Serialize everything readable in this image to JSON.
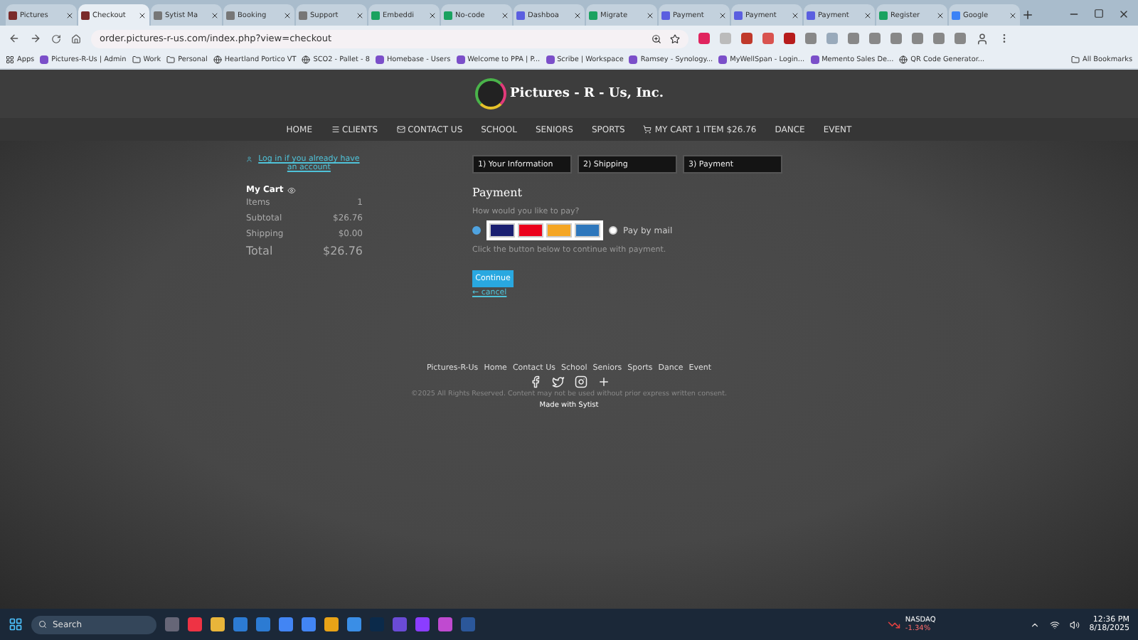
{
  "browser": {
    "tabs": [
      {
        "label": "Pictures",
        "selected": false,
        "color": "#7a2a2a"
      },
      {
        "label": "Checkout",
        "selected": true,
        "color": "#7a2a2a"
      },
      {
        "label": "Sytist Ma",
        "selected": false,
        "color": "#777777"
      },
      {
        "label": "Booking",
        "selected": false,
        "color": "#777777"
      },
      {
        "label": "Support",
        "selected": false,
        "color": "#777777"
      },
      {
        "label": "Embeddi",
        "selected": false,
        "color": "#1aa260"
      },
      {
        "label": "No-code",
        "selected": false,
        "color": "#1aa260"
      },
      {
        "label": "Dashboa",
        "selected": false,
        "color": "#5b5fe0"
      },
      {
        "label": "Migrate",
        "selected": false,
        "color": "#1aa260"
      },
      {
        "label": "Payment",
        "selected": false,
        "color": "#5b5fe0"
      },
      {
        "label": "Payment",
        "selected": false,
        "color": "#5b5fe0"
      },
      {
        "label": "Payment",
        "selected": false,
        "color": "#5b5fe0"
      },
      {
        "label": "Register",
        "selected": false,
        "color": "#1aa260"
      },
      {
        "label": "Google",
        "selected": false,
        "color": "#3b82f6"
      }
    ],
    "url": "order.pictures-r-us.com/index.php?view=checkout",
    "bookmarks": [
      {
        "label": "Apps",
        "kind": "apps"
      },
      {
        "label": "Pictures-R-Us | Admin",
        "kind": "site"
      },
      {
        "label": "Work",
        "kind": "folder"
      },
      {
        "label": "Personal",
        "kind": "folder"
      },
      {
        "label": "Heartland Portico VT",
        "kind": "globe"
      },
      {
        "label": "SCO2 - Pallet - 8",
        "kind": "globe"
      },
      {
        "label": "Homebase - Users",
        "kind": "site"
      },
      {
        "label": "Welcome to PPA | P...",
        "kind": "site"
      },
      {
        "label": "Scribe | Workspace",
        "kind": "site"
      },
      {
        "label": "Ramsey - Synology...",
        "kind": "site"
      },
      {
        "label": "MyWellSpan - Login...",
        "kind": "site"
      },
      {
        "label": "Memento Sales De...",
        "kind": "site"
      },
      {
        "label": "QR Code Generator...",
        "kind": "globe"
      }
    ],
    "all_bookmarks": "All Bookmarks"
  },
  "site": {
    "brand": "Pictures - R - Us, Inc.",
    "nav": [
      {
        "label": "HOME",
        "kind": "plain"
      },
      {
        "label": "CLIENTS",
        "kind": "menu"
      },
      {
        "label": "CONTACT US",
        "kind": "mail"
      },
      {
        "label": "SCHOOL",
        "kind": "plain"
      },
      {
        "label": "SENIORS",
        "kind": "plain"
      },
      {
        "label": "SPORTS",
        "kind": "plain"
      },
      {
        "label": "MY CART 1 ITEM $26.76",
        "kind": "cart"
      },
      {
        "label": "DANCE",
        "kind": "plain"
      },
      {
        "label": "EVENT",
        "kind": "plain"
      }
    ],
    "login_link": "Log in if you already have an account",
    "cart": {
      "title": "My Cart",
      "rows": [
        {
          "label": "Items",
          "value": "1",
          "total": false
        },
        {
          "label": "Subtotal",
          "value": "$26.76",
          "total": false
        },
        {
          "label": "Shipping",
          "value": "$0.00",
          "total": false
        },
        {
          "label": "Total",
          "value": "$26.76",
          "total": true
        }
      ]
    },
    "steps": [
      {
        "label": "1) Your Information"
      },
      {
        "label": "2) Shipping"
      },
      {
        "label": "3) Payment"
      }
    ],
    "payment": {
      "title": "Payment",
      "question": "How would you like to pay?",
      "options": [
        {
          "kind": "cards",
          "selected": true
        },
        {
          "kind": "mail",
          "label": "Pay by mail",
          "selected": false
        }
      ],
      "instruction": "Click the button below to continue with payment.",
      "continue": "Continue",
      "cancel": "← cancel"
    },
    "footer": {
      "links": [
        "Pictures-R-Us",
        "Home",
        "Contact Us",
        "School",
        "Seniors",
        "Sports",
        "Dance",
        "Event"
      ],
      "copyright": "©2025 All Rights Reserved. Content may not be used without prior express written consent.",
      "made_with": "Made with Sytist"
    }
  },
  "taskbar": {
    "search": "Search",
    "stock": {
      "name": "NASDAQ",
      "change": "-1.34%"
    },
    "time": "12:36 PM",
    "date": "8/18/2025"
  }
}
